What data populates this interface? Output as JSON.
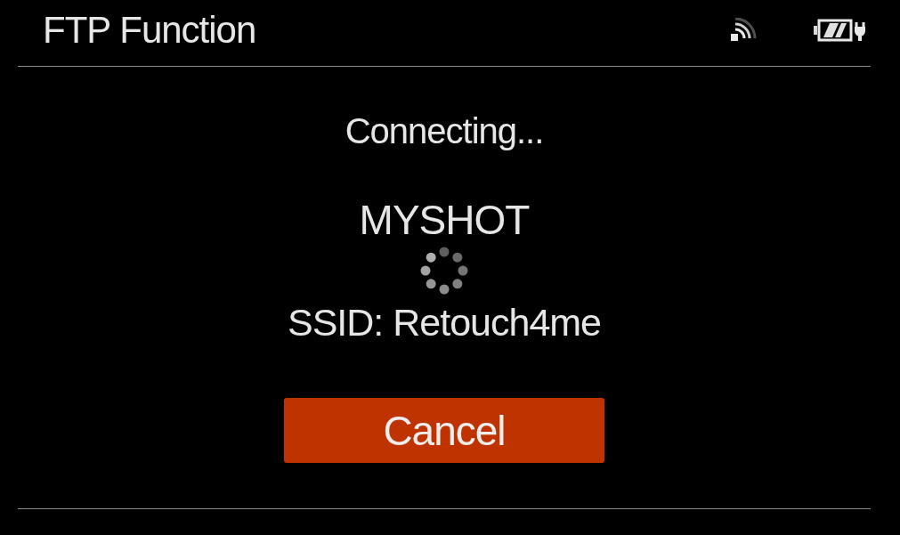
{
  "header": {
    "title": "FTP Function"
  },
  "status": "Connecting...",
  "server": "MYSHOT",
  "ssid": "SSID: Retouch4me",
  "buttons": [
    {
      "label": "Cancel",
      "kind": "primary"
    }
  ]
}
